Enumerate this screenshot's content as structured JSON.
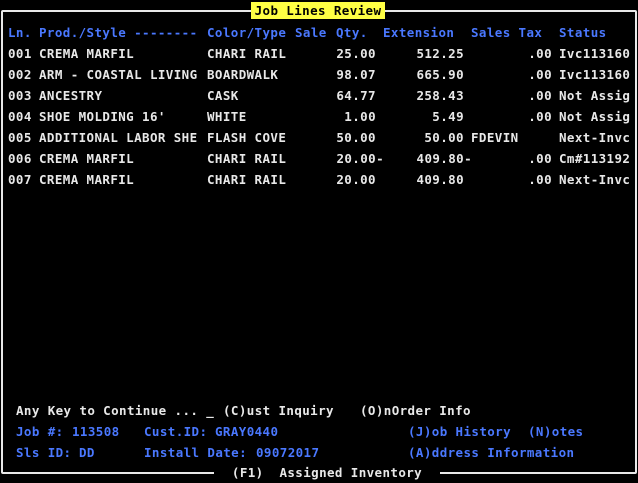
{
  "title": "Job Lines Review",
  "columns": {
    "ln": "Ln.",
    "prod": "Prod./Style --------",
    "color": "Color/Type",
    "sale": "Sale",
    "qty": "Qty.",
    "extension": "Extension",
    "sales_tax": "Sales Tax",
    "status": "Status"
  },
  "rows": [
    {
      "ln": "001",
      "prod": "CREMA MARFIL",
      "color": "CHARI RAIL",
      "qty": "25.00",
      "extension": "512.25",
      "tax": ".00",
      "status": "Ivc113160"
    },
    {
      "ln": "002",
      "prod": "ARM - COASTAL LIVING",
      "color": "BOARDWALK",
      "qty": "98.07",
      "extension": "665.90",
      "tax": ".00",
      "status": "Ivc113160"
    },
    {
      "ln": "003",
      "prod": "ANCESTRY",
      "color": "CASK",
      "qty": "64.77",
      "extension": "258.43",
      "tax": ".00",
      "status": "Not Assig"
    },
    {
      "ln": "004",
      "prod": "SHOE MOLDING 16'",
      "color": "WHITE",
      "qty": "1.00",
      "extension": "5.49",
      "tax": ".00",
      "status": "Not Assig"
    },
    {
      "ln": "005",
      "prod": "ADDITIONAL LABOR SHE",
      "color": "FLASH COVE",
      "qty": "50.00",
      "extension": "50.00",
      "tax": "FDEVIN",
      "status": "Next-Invc"
    },
    {
      "ln": "006",
      "prod": "CREMA MARFIL",
      "color": "CHARI RAIL",
      "qty": "20.00-",
      "extension": "409.80-",
      "tax": ".00",
      "status": "Cm#113192"
    },
    {
      "ln": "007",
      "prod": "CREMA MARFIL",
      "color": "CHARI RAIL",
      "qty": "20.00",
      "extension": "409.80",
      "tax": ".00",
      "status": "Next-Invc"
    }
  ],
  "prompt": {
    "any_key": "Any Key to Continue ... _",
    "cust_inquiry": "(C)ust Inquiry",
    "onorder": "(O)nOrder Info"
  },
  "job": {
    "job_label": "Job #:",
    "job_value": "113508",
    "cust_label": "Cust.ID:",
    "cust_value": "GRAY0440",
    "sls_label": "Sls ID:",
    "sls_value": "DD",
    "install_label": "Install Date:",
    "install_value": "09072017",
    "job_history": "(J)ob History",
    "notes": "(N)otes",
    "address_info": "(A)ddress Information"
  },
  "footer": "(F1)  Assigned Inventory",
  "colors": {
    "background": "#000000",
    "text": "#e8e8e8",
    "header": "#4a78ff",
    "title_bg": "#ffff44"
  }
}
